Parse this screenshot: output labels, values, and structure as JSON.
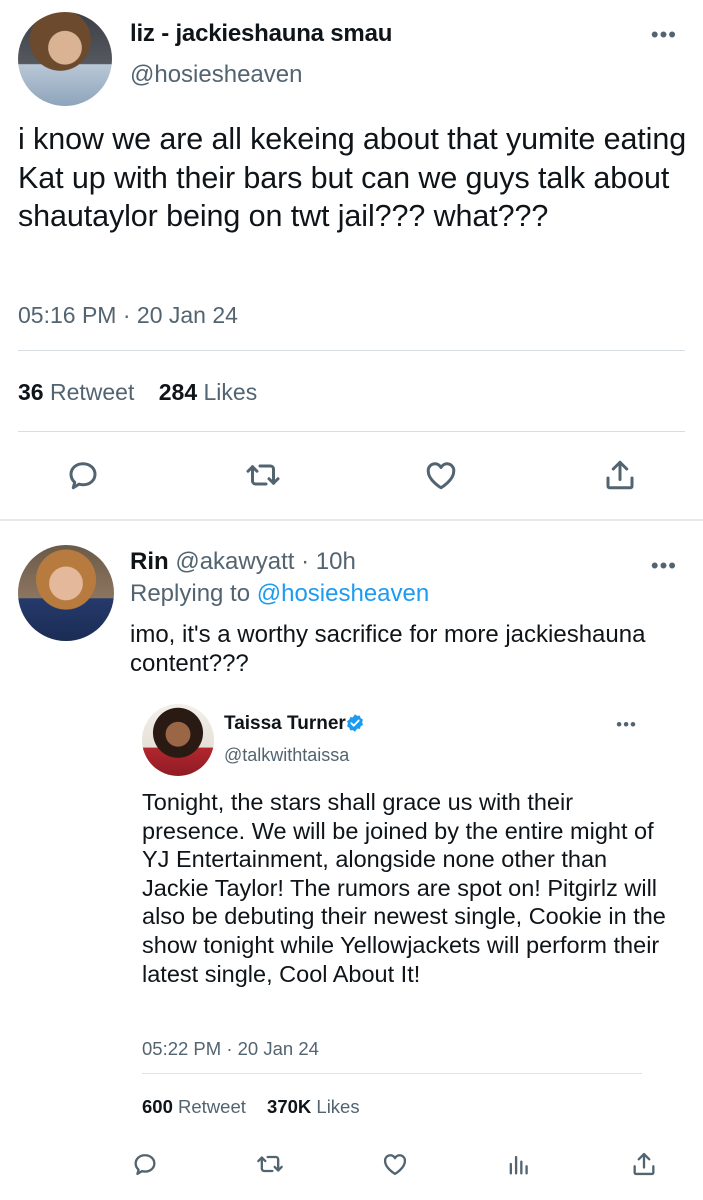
{
  "tweet": {
    "display_name": "liz - jackieshauna smau",
    "handle": "@hosiesheaven",
    "text": "i know we are all kekeing about that yumite eating Kat up with their bars but can we guys talk about shautaylor being on twt jail??? what???",
    "time": "05:16 PM",
    "date": "20 Jan 24",
    "meta_sep": " · ",
    "retweet_count": "36",
    "retweet_label": "Retweet",
    "likes_count": "284",
    "likes_label": "Likes",
    "more": "•••"
  },
  "reply": {
    "display_name": "Rin",
    "handle": "@akawyatt",
    "time": "· 10h",
    "replying_to_label": "Replying to",
    "replying_to_handle": "@hosiesheaven",
    "text": "imo, it's a worthy sacrifice for more jackieshauna content???",
    "more": "•••"
  },
  "quoted": {
    "display_name": "Taissa Turner",
    "handle": "@talkwithtaissa",
    "text": "Tonight, the stars shall grace us with their presence. We will be joined by the entire might of YJ Entertainment, alongside none other than Jackie Taylor! The rumors are spot on! Pitgirlz will also be debuting their newest single, Cookie in the show tonight while Yellowjackets will perform their latest single, Cool About It!",
    "time": "05:22 PM",
    "date": "20 Jan 24",
    "meta_sep": " · ",
    "retweet_count": "600",
    "retweet_label": "Retweet",
    "likes_count": "370K",
    "likes_label": "Likes",
    "more": "•••"
  },
  "colors": {
    "text": "#0f1419",
    "secondary": "#536471",
    "link": "#1d9bf0",
    "divider": "#d7dde1"
  },
  "icons": [
    "reply-icon",
    "retweet-icon",
    "like-icon",
    "share-icon",
    "views-icon",
    "verified-badge-icon",
    "more-icon"
  ]
}
